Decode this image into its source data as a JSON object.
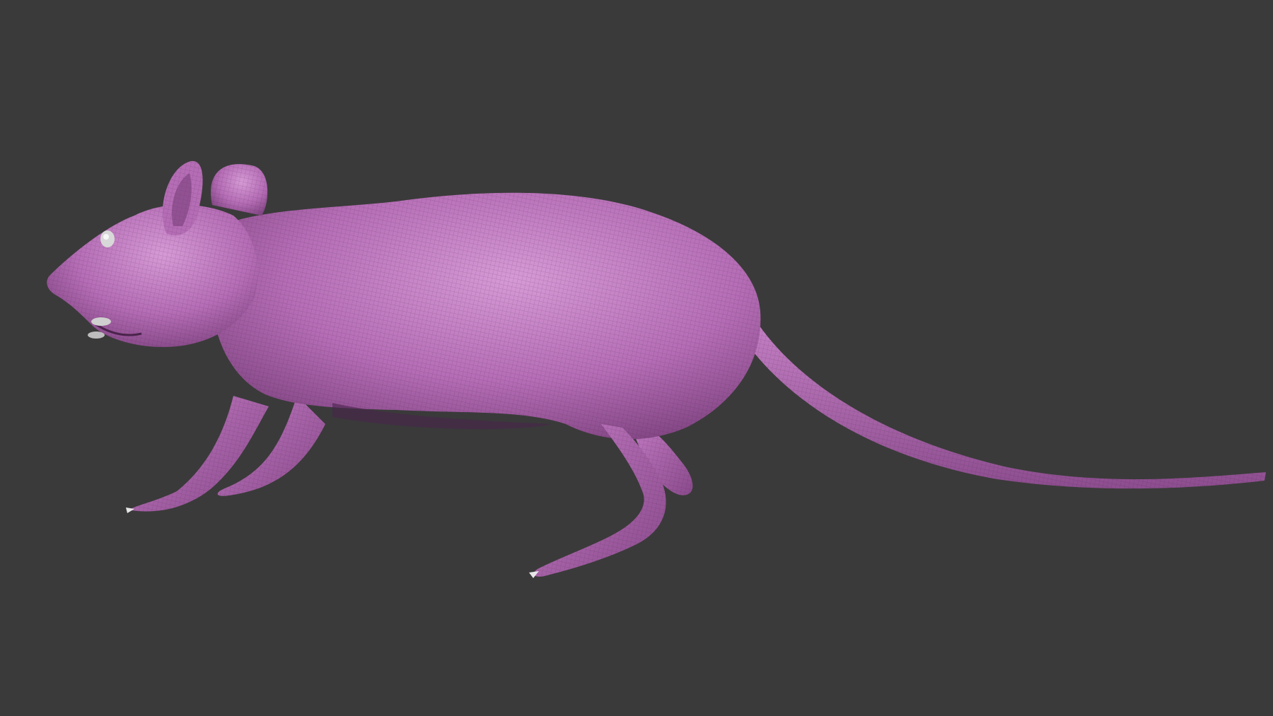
{
  "viewport": {
    "background_color": "#3a3a3a"
  },
  "model": {
    "subject": "rat-sculpt",
    "material_color": "#b56db5",
    "highlight_color": "#d69ad6",
    "shadow_color": "#6e3a70",
    "wireframe_visible": true,
    "eye_color": "#d8d8d8",
    "claw_color": "#e6e6e6"
  }
}
